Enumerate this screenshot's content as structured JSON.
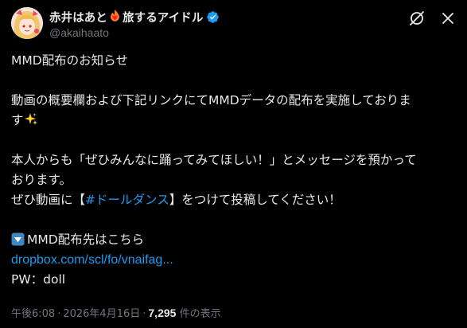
{
  "author": {
    "name_part1": "赤井はあと",
    "name_part2": "旅するアイドル",
    "handle": "@akaihaato",
    "name_emoji": "fire-heart-emoji",
    "verified": true
  },
  "header": {
    "grok_icon": "grok-icon",
    "close_icon": "close-icon"
  },
  "post": {
    "line1": "MMD配布のお知らせ",
    "line2": "動画の概要欄および下記リンクにてMMDデータの配布を実施しておりま",
    "line3": "す",
    "line4": "本人からも「ぜひみんなに踊ってみてほしい！」とメッセージを預かって",
    "line5": "おります。",
    "line6_prefix": "ぜひ動画に【",
    "hashtag": "#ドールダンス",
    "line6_suffix": "】をつけて投稿してください！",
    "line7": "MMD配布先はこちら",
    "link": "dropbox.com/scl/fo/vnaifag...",
    "pw": "PW：doll"
  },
  "meta": {
    "time": "午後6:08",
    "date": "2026年4月16日",
    "views": "7,295",
    "views_label": "件の表示"
  },
  "colors": {
    "background": "#000000",
    "text": "#e7e9ea",
    "muted": "#71767b",
    "accent": "#1d9bf0"
  }
}
